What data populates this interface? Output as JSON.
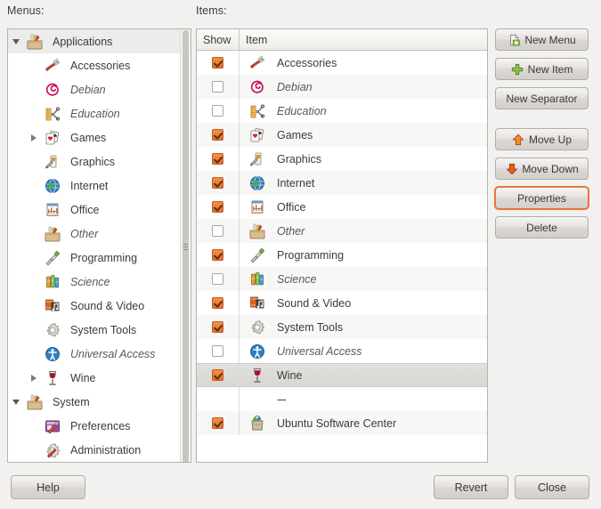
{
  "labels": {
    "menus": "Menus:",
    "items": "Items:"
  },
  "colors": {
    "accent_orange": "#e4702a",
    "focus_ring": "#e8763a",
    "window_bg": "#f2f1f0",
    "panel_bg": "#ffffff",
    "selection_bg": "#dedcd7"
  },
  "tree": {
    "nodes": [
      {
        "label": "Applications",
        "icon": "toolbox-icon",
        "indent": 0,
        "expander": "down",
        "selected": true,
        "dim": false
      },
      {
        "label": "Accessories",
        "icon": "accessories-icon",
        "indent": 1,
        "expander": "none",
        "selected": false,
        "dim": false
      },
      {
        "label": "Debian",
        "icon": "debian-icon",
        "indent": 1,
        "expander": "none",
        "selected": false,
        "dim": true
      },
      {
        "label": "Education",
        "icon": "education-icon",
        "indent": 1,
        "expander": "none",
        "selected": false,
        "dim": true
      },
      {
        "label": "Games",
        "icon": "games-icon",
        "indent": 1,
        "expander": "right",
        "selected": false,
        "dim": false
      },
      {
        "label": "Graphics",
        "icon": "graphics-icon",
        "indent": 1,
        "expander": "none",
        "selected": false,
        "dim": false
      },
      {
        "label": "Internet",
        "icon": "internet-icon",
        "indent": 1,
        "expander": "none",
        "selected": false,
        "dim": false
      },
      {
        "label": "Office",
        "icon": "office-icon",
        "indent": 1,
        "expander": "none",
        "selected": false,
        "dim": false
      },
      {
        "label": "Other",
        "icon": "toolbox-icon",
        "indent": 1,
        "expander": "none",
        "selected": false,
        "dim": true
      },
      {
        "label": "Programming",
        "icon": "programming-icon",
        "indent": 1,
        "expander": "none",
        "selected": false,
        "dim": false
      },
      {
        "label": "Science",
        "icon": "science-icon",
        "indent": 1,
        "expander": "none",
        "selected": false,
        "dim": true
      },
      {
        "label": "Sound & Video",
        "icon": "sound-video-icon",
        "indent": 1,
        "expander": "none",
        "selected": false,
        "dim": false
      },
      {
        "label": "System Tools",
        "icon": "system-tools-icon",
        "indent": 1,
        "expander": "none",
        "selected": false,
        "dim": false
      },
      {
        "label": "Universal Access",
        "icon": "universal-access-icon",
        "indent": 1,
        "expander": "none",
        "selected": false,
        "dim": true
      },
      {
        "label": "Wine",
        "icon": "wine-icon",
        "indent": 1,
        "expander": "right",
        "selected": false,
        "dim": false
      },
      {
        "label": "System",
        "icon": "toolbox-icon",
        "indent": 0,
        "expander": "down",
        "selected": false,
        "dim": false
      },
      {
        "label": "Preferences",
        "icon": "preferences-icon",
        "indent": 1,
        "expander": "none",
        "selected": false,
        "dim": false
      },
      {
        "label": "Administration",
        "icon": "administration-icon",
        "indent": 1,
        "expander": "none",
        "selected": false,
        "dim": false
      }
    ]
  },
  "items_table": {
    "columns": [
      "Show",
      "Item"
    ],
    "rows": [
      {
        "show": true,
        "label": "Accessories",
        "icon": "accessories-icon",
        "dim": false,
        "selected": false,
        "separator": false
      },
      {
        "show": false,
        "label": "Debian",
        "icon": "debian-icon",
        "dim": true,
        "selected": false,
        "separator": false
      },
      {
        "show": false,
        "label": "Education",
        "icon": "education-icon",
        "dim": true,
        "selected": false,
        "separator": false
      },
      {
        "show": true,
        "label": "Games",
        "icon": "games-icon",
        "dim": false,
        "selected": false,
        "separator": false
      },
      {
        "show": true,
        "label": "Graphics",
        "icon": "graphics-icon",
        "dim": false,
        "selected": false,
        "separator": false
      },
      {
        "show": true,
        "label": "Internet",
        "icon": "internet-icon",
        "dim": false,
        "selected": false,
        "separator": false
      },
      {
        "show": true,
        "label": "Office",
        "icon": "office-icon",
        "dim": false,
        "selected": false,
        "separator": false
      },
      {
        "show": false,
        "label": "Other",
        "icon": "toolbox-icon",
        "dim": true,
        "selected": false,
        "separator": false
      },
      {
        "show": true,
        "label": "Programming",
        "icon": "programming-icon",
        "dim": false,
        "selected": false,
        "separator": false
      },
      {
        "show": false,
        "label": "Science",
        "icon": "science-icon",
        "dim": true,
        "selected": false,
        "separator": false
      },
      {
        "show": true,
        "label": "Sound & Video",
        "icon": "sound-video-icon",
        "dim": false,
        "selected": false,
        "separator": false
      },
      {
        "show": true,
        "label": "System Tools",
        "icon": "system-tools-icon",
        "dim": false,
        "selected": false,
        "separator": false
      },
      {
        "show": false,
        "label": "Universal Access",
        "icon": "universal-access-icon",
        "dim": true,
        "selected": false,
        "separator": false
      },
      {
        "show": true,
        "label": "Wine",
        "icon": "wine-icon",
        "dim": false,
        "selected": true,
        "separator": false
      },
      {
        "show": null,
        "label": "---",
        "icon": "none",
        "dim": false,
        "selected": false,
        "separator": true
      },
      {
        "show": true,
        "label": "Ubuntu Software Center",
        "icon": "software-center-icon",
        "dim": false,
        "selected": false,
        "separator": false
      }
    ]
  },
  "side_buttons": [
    {
      "label": "New Menu",
      "icon": "new-menu-icon",
      "focused": false,
      "gap_after": false
    },
    {
      "label": "New Item",
      "icon": "plus-icon",
      "focused": false,
      "gap_after": false
    },
    {
      "label": "New Separator",
      "icon": "none",
      "focused": false,
      "gap_after": true
    },
    {
      "label": "Move Up",
      "icon": "arrow-up-icon",
      "focused": false,
      "gap_after": false
    },
    {
      "label": "Move Down",
      "icon": "arrow-down-icon",
      "focused": false,
      "gap_after": false
    },
    {
      "label": "Properties",
      "icon": "none",
      "focused": true,
      "gap_after": false
    },
    {
      "label": "Delete",
      "icon": "none",
      "focused": false,
      "gap_after": false
    }
  ],
  "bottom_buttons": {
    "help": "Help",
    "revert": "Revert",
    "close": "Close"
  }
}
